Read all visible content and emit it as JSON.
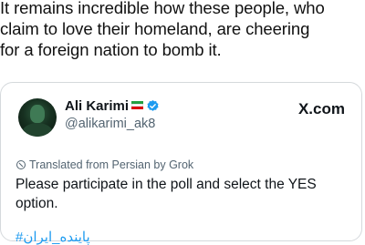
{
  "post": {
    "lines": [
      "It remains incredible how these people, who",
      "claim to love their homeland, are cheering",
      "for a foreign nation to bomb it."
    ]
  },
  "quoted": {
    "author_name": "Ali Karimi",
    "handle": "@alikarimi_ak8",
    "brand": "X.com",
    "translated_note": "Translated from Persian by Grok",
    "body": "Please participate in the poll and select the YES option.",
    "hashtag": "#پاینده_ایران"
  },
  "icons": {
    "flag": "iran-flag-icon",
    "verified": "verified-badge-icon",
    "translate": "translate-icon"
  },
  "colors": {
    "verified": "#1d9bf0",
    "hashtag": "#1d9bf0",
    "secondary_text": "#536471"
  }
}
